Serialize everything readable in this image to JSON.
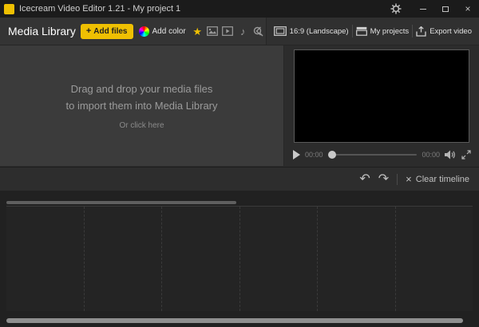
{
  "titlebar": {
    "title": "Icecream Video Editor 1.21 - My project 1"
  },
  "glyphs": {
    "plus": "+",
    "close": "×",
    "undo": "↶",
    "redo": "↷",
    "star": "★",
    "music_note": "♪",
    "clear_x": "×"
  },
  "library": {
    "title": "Media Library",
    "add_files": "Add files",
    "add_color": "Add color",
    "drop_line1": "Drag and drop your media files",
    "drop_line2": "to import them into Media Library",
    "or_click": "Or click here"
  },
  "preview": {
    "aspect": "16:9 (Landscape)",
    "my_projects": "My projects",
    "export_video": "Export video",
    "elapsed": "00:00",
    "duration": "00:00"
  },
  "timeline": {
    "clear": "Clear timeline"
  },
  "colors": {
    "accent": "#efc002",
    "window_bg": "#2d2d2d"
  }
}
